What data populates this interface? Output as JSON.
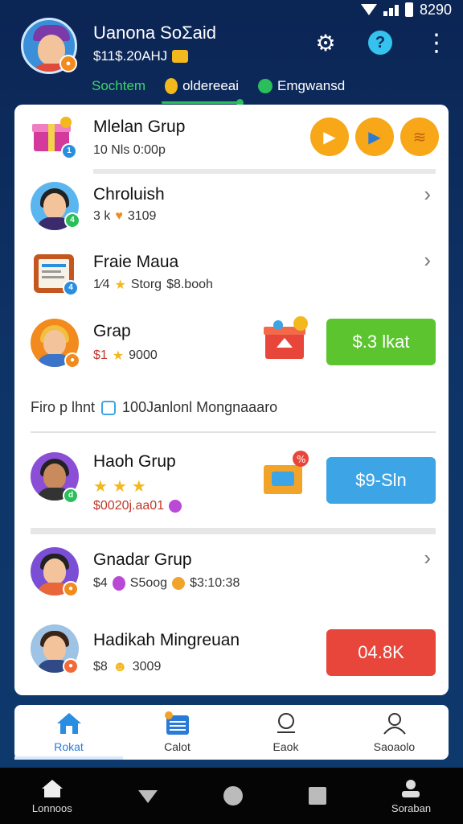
{
  "header": {
    "user_name": "Uanona SoΣaid",
    "balance": "$11$.20AHJ",
    "tabs": [
      "Sochtem",
      "oldereeai",
      "Emgwansd"
    ]
  },
  "groups": [
    {
      "title": "Mlelan Grup",
      "sub": "10 Nls 0:00p"
    },
    {
      "title": "Chroluish",
      "sub_a": "3 k",
      "sub_b": "3109"
    },
    {
      "title": "Fraie Maua",
      "sub_a": "1∕4",
      "sub_b": "Storg",
      "sub_c": "$8.booh"
    },
    {
      "title": "Grap",
      "sub_a": "$1",
      "sub_b": "9000",
      "button": "$.3 lkat"
    },
    {
      "title": "Haoh Grup",
      "sub": "$0020j.aa01",
      "button": "$9-Sln"
    },
    {
      "title": "Gnadar Grup",
      "sub_a": "$4",
      "sub_b": "S5oog",
      "sub_c": "$3:10:38"
    },
    {
      "title": "Hadikah Mingreuan",
      "sub_a": "$8",
      "sub_b": "3009",
      "button": "04.8K"
    }
  ],
  "info_line": {
    "left": "Firo p lhnt",
    "right": "100Ja​nlonl Mongnaaaro"
  },
  "app_nav": [
    {
      "label": "Rokat"
    },
    {
      "label": "Calot"
    },
    {
      "label": "Eaok"
    },
    {
      "label": "Saoaolo"
    }
  ],
  "sys_nav": {
    "left": "Lonnoos",
    "right": "Soraban"
  },
  "status": {
    "time": "8290"
  },
  "colors": {
    "accent_green": "#5cc42f",
    "accent_blue": "#3da4e6",
    "accent_red": "#e8463a",
    "bg": "#0e3467"
  }
}
